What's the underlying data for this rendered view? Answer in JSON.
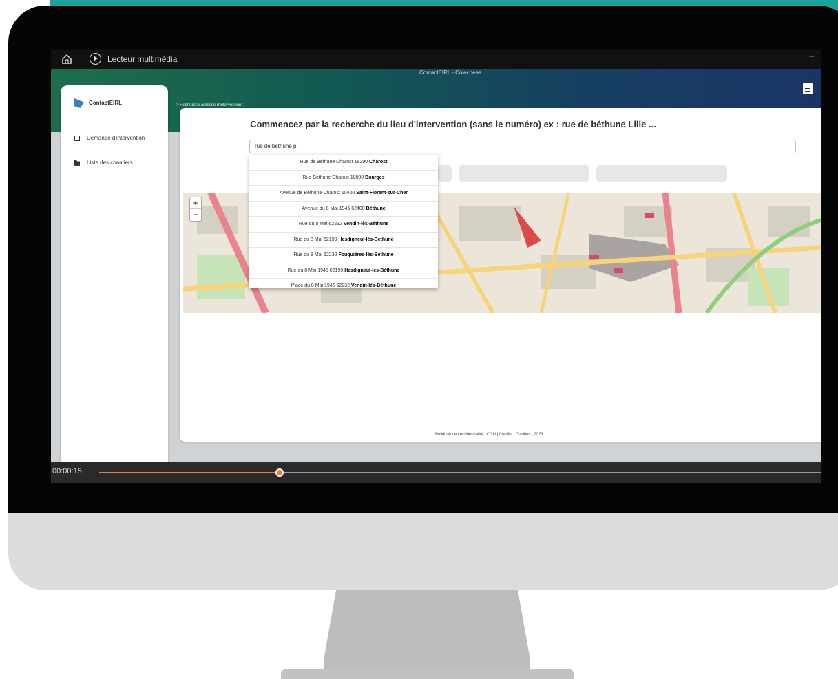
{
  "player": {
    "app_name": "Lecteur multimédia",
    "window_title": "ContactEIRL - Colecheas",
    "minimize_glyph": "–",
    "time": "00:00:15",
    "progress_fraction": 0.25,
    "accent_color": "#f07c2e"
  },
  "sidebar": {
    "logo_text": "ContactEIRL",
    "items": [
      {
        "label": "Demande d'intervention",
        "icon": "checkbox-icon"
      },
      {
        "label": "Liste des chantiers",
        "icon": "folder-icon"
      }
    ]
  },
  "main": {
    "breadcrumb": "> Recherche adresse d'intervention :",
    "heading": "Commencez par la recherche du lieu d'intervention (sans le numéro) ex : rue de béthune Lille ...",
    "search": {
      "value": "rue de béthune p"
    },
    "suggestions": [
      {
        "prefix": "Rue de Béthune Charost 18290",
        "city": "Chârost"
      },
      {
        "prefix": "Rue Béthune Charost 18000",
        "city": "Bourges"
      },
      {
        "prefix": "Avenue de Béthune Charost 10400",
        "city": "Saint-Florent-sur-Cher"
      },
      {
        "prefix": "Avenue du 8 Mai 1945 62400",
        "city": "Béthune"
      },
      {
        "prefix": "Rue du 8 Mai 62232",
        "city": "Vendin-lès-Béthune"
      },
      {
        "prefix": "Rue du 8 Mai 62199",
        "city": "Hesdigneul-lès-Béthune"
      },
      {
        "prefix": "Rue du 8 Mai 62232",
        "city": "Fouquières-lès-Béthune"
      },
      {
        "prefix": "Rue du 8 Mai 1945 62199",
        "city": "Hesdigneul-lès-Béthune"
      },
      {
        "prefix": "Place du 8 Mai 1945 62232",
        "city": "Vendin-lès-Béthune"
      }
    ],
    "map": {
      "zoom_in": "+",
      "zoom_out": "−"
    },
    "footer": "Politique de confidentialité | CGU | Crédits | Cookies | 2023"
  },
  "colors": {
    "header_start": "#1d6e4b",
    "header_end": "#1b3466",
    "teal_band": "#1aa39a"
  }
}
